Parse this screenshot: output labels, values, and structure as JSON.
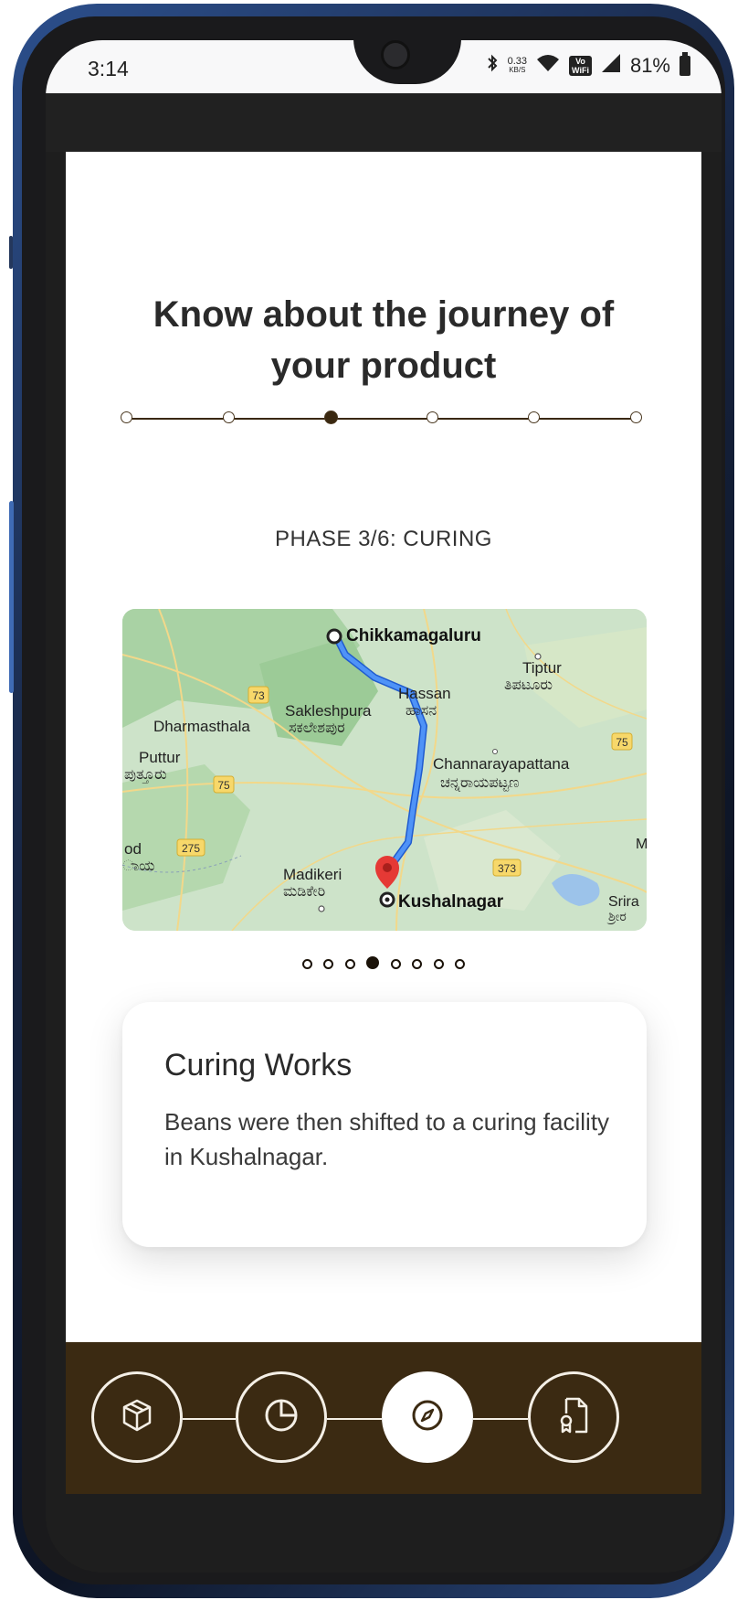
{
  "status_bar": {
    "time": "3:14",
    "net_speed_value": "0.33",
    "net_speed_unit": "KB/S",
    "volte_line1": "Vo",
    "volte_line2": "WiFi",
    "battery": "81%"
  },
  "header": {
    "title_line1": "Know about the journey of",
    "title_line2": "your product"
  },
  "stepper": {
    "total_steps": 6,
    "current_step": 3
  },
  "phase": {
    "label": "PHASE 3/6: CURING"
  },
  "map": {
    "origin": "Chikkamagaluru",
    "destination": "Kushalnagar",
    "labels": {
      "tiptur": "Tiptur",
      "tiptur_kn": "ತಿಪಟೂರು",
      "hassan": "Hassan",
      "hassan_kn": "ಹಾಸನ",
      "sakleshpura": "Sakleshpura",
      "sakleshpura_kn": "ಸಕಲೇಶಪುರ",
      "dharmasthala": "Dharmasthala",
      "puttur": "Puttur",
      "puttur_kn": "ಪುತ್ತೂರು",
      "channarayapattana": "Channarayapattana",
      "channarayapattana_kn": "ಚನ್ನರಾಯಪಟ್ಟಣ",
      "madikeri": "Madikeri",
      "madikeri_kn": "ಮಡಿಕೇರಿ",
      "od": "od",
      "od_kn": "ಾಯ",
      "srira": "Srira",
      "srira_kn": "ಶ್ರೀರ",
      "m": "M"
    },
    "road_badges": {
      "r73": "73",
      "r75a": "75",
      "r75b": "75",
      "r275": "275",
      "r373": "373"
    },
    "colors": {
      "route": "#3d7de8",
      "pin": "#e53935",
      "badge": "#f7d86a"
    }
  },
  "carousel": {
    "total": 8,
    "active_index": 3
  },
  "info_card": {
    "title": "Curing Works",
    "body": "Beans were then shifted to a curing facility in Kushalnagar."
  },
  "bottom_nav": {
    "items": [
      {
        "icon": "box-icon",
        "active": false
      },
      {
        "icon": "pie-chart-icon",
        "active": false
      },
      {
        "icon": "compass-icon",
        "active": true
      },
      {
        "icon": "certificate-document-icon",
        "active": false
      }
    ],
    "colors": {
      "background": "#3b2a12",
      "foreground": "#f4efe6"
    }
  }
}
